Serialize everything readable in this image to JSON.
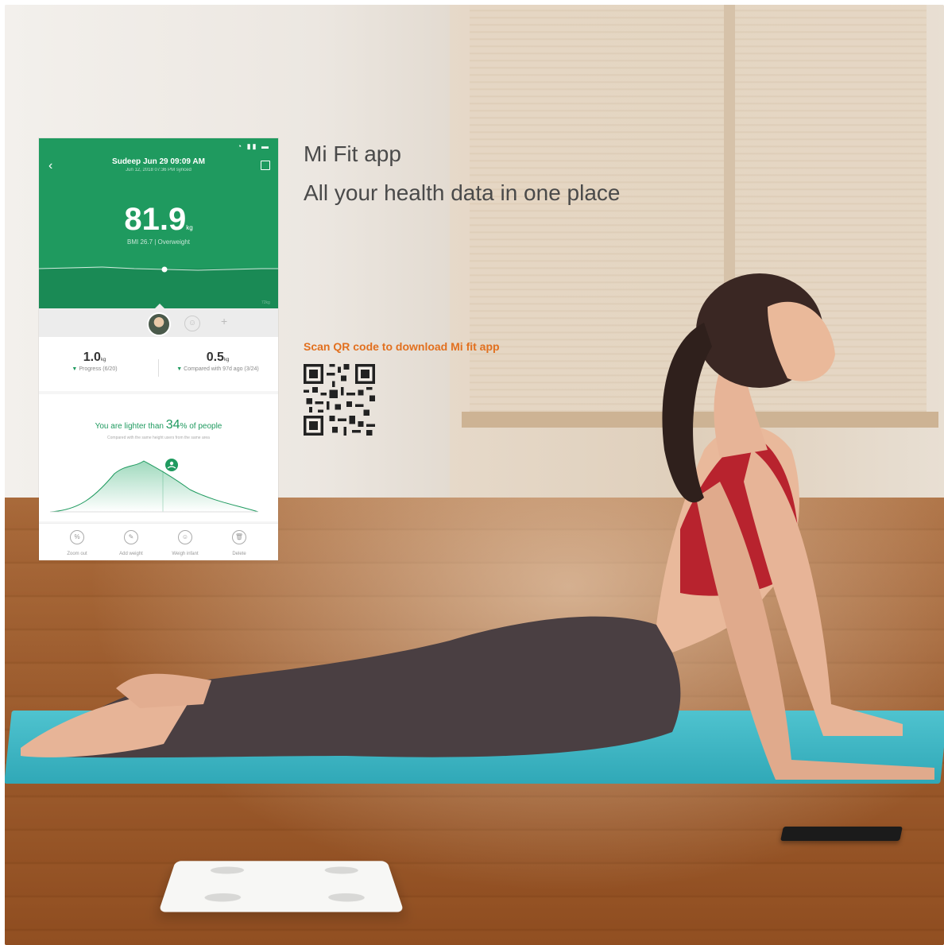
{
  "app": {
    "header_title": "Sudeep  Jun 29 09:09 AM",
    "header_sub": "Jun 12, 2018 07:36 PM synced",
    "weight_value": "81.9",
    "weight_unit": "kg",
    "bmi_text": "BMI 26.7  |  Overweight",
    "trend_label": "72kg",
    "stat_left_value": "1.0",
    "stat_left_unit": "kg",
    "stat_left_label": "Progress (6/20)",
    "stat_right_value": "0.5",
    "stat_right_unit": "kg",
    "stat_right_label": "Compared with 97d ago (3/24)",
    "compare_prefix": "You are lighter than ",
    "compare_percent": "34",
    "compare_suffix": "% of people",
    "compare_sub": "Compared with the same height users from the same area",
    "tabs": [
      {
        "label": "Zoom out",
        "icon": "zoom-out-icon",
        "glyph": "%"
      },
      {
        "label": "Add weight",
        "icon": "edit-icon",
        "glyph": "✎"
      },
      {
        "label": "Weigh infant",
        "icon": "infant-icon",
        "glyph": "☺"
      },
      {
        "label": "Delete",
        "icon": "trash-icon",
        "glyph": "🗑"
      }
    ]
  },
  "heading": {
    "line1": "Mi Fit app",
    "line2": "All your health data in one place"
  },
  "qr_label": "Scan QR code to download Mi fit app",
  "colors": {
    "app_green": "#1f9a5f",
    "qr_label": "#e2701f",
    "heading": "#4a4a4a",
    "mat": "#3fb7c4"
  }
}
